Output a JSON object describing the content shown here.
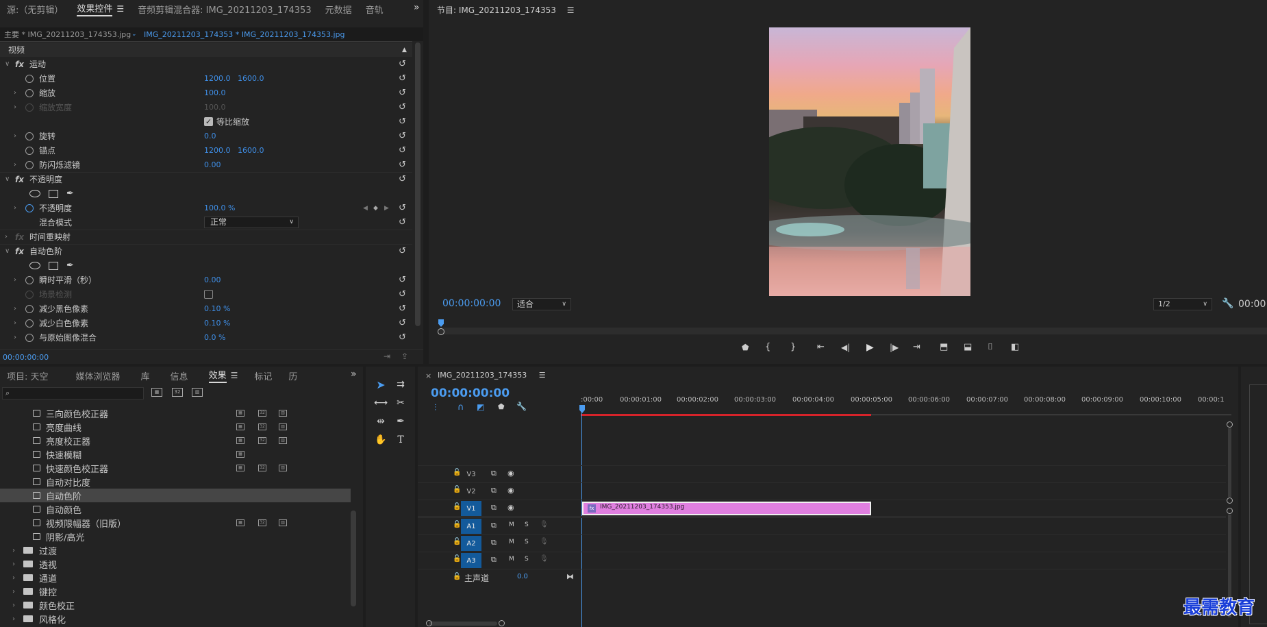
{
  "effect_controls_panel": {
    "tabs": [
      "源:（无剪辑）",
      "效果控件",
      "音频剪辑混合器: IMG_20211203_174353",
      "元数据",
      "音轨"
    ],
    "active_tab": "效果控件",
    "master_clip": "主要 * IMG_20211203_174353.jpg",
    "sequence_clip": "IMG_20211203_174353 * IMG_20211203_174353.jpg",
    "section_video": "视频",
    "motion": {
      "label": "运动",
      "position": {
        "label": "位置",
        "x": "1200.0",
        "y": "1600.0"
      },
      "scale": {
        "label": "缩放",
        "value": "100.0"
      },
      "scale_width": {
        "label": "缩放宽度",
        "value": "100.0"
      },
      "uniform_scale": "等比缩放",
      "rotation": {
        "label": "旋转",
        "value": "0.0"
      },
      "anchor": {
        "label": "锚点",
        "x": "1200.0",
        "y": "1600.0"
      },
      "anti_flicker": {
        "label": "防闪烁滤镜",
        "value": "0.00"
      }
    },
    "opacity": {
      "label": "不透明度",
      "opacity": {
        "label": "不透明度",
        "value": "100.0 %"
      },
      "blend_mode": {
        "label": "混合模式",
        "value": "正常"
      }
    },
    "time_remap": "时间重映射",
    "auto_levels": {
      "label": "自动色阶",
      "smoothing": {
        "label": "瞬时平滑（秒）",
        "value": "0.00"
      },
      "scene_detect": "场景检测",
      "black_clip": {
        "label": "减少黑色像素",
        "value": "0.10 %"
      },
      "white_clip": {
        "label": "减少白色像素",
        "value": "0.10 %"
      },
      "blend_original": {
        "label": "与原始图像混合",
        "value": "0.0 %"
      }
    },
    "timecode": "00:00:00:00"
  },
  "program_monitor": {
    "title": "节目: IMG_20211203_174353",
    "timecode": "00:00:00:00",
    "fit": "适合",
    "resolution": "1/2",
    "timecode_right": "00:00:"
  },
  "project_panel": {
    "tabs": [
      "项目: 天空",
      "媒体浏览器",
      "库",
      "信息",
      "效果",
      "标记",
      "历"
    ],
    "active_tab": "效果",
    "search_placeholder": "",
    "effects": [
      "三向颜色校正器",
      "亮度曲线",
      "亮度校正器",
      "快速模糊",
      "快速颜色校正器",
      "自动对比度",
      "自动色阶",
      "自动颜色",
      "视频限幅器（旧版）",
      "阴影/高光"
    ],
    "selected_effect": "自动色阶",
    "folders": [
      "过渡",
      "透视",
      "通道",
      "键控",
      "颜色校正",
      "风格化"
    ]
  },
  "timeline": {
    "sequence_name": "IMG_20211203_174353",
    "timecode": "00:00:00:00",
    "ruler": [
      ":00:00",
      "00:00:01:00",
      "00:00:02:00",
      "00:00:03:00",
      "00:00:04:00",
      "00:00:05:00",
      "00:00:06:00",
      "00:00:07:00",
      "00:00:08:00",
      "00:00:09:00",
      "00:00:10:00",
      "00:00:1"
    ],
    "video_tracks": [
      "V3",
      "V2",
      "V1"
    ],
    "audio_tracks": [
      "A1",
      "A2",
      "A3"
    ],
    "master": {
      "label": "主声道",
      "value": "0.0"
    },
    "clip_name": "IMG_20211203_174353.jpg",
    "m": "M",
    "s": "S"
  },
  "watermark": "最需教育",
  "colors": {
    "accent": "#4b9cf0",
    "clip": "#e07fe0",
    "track_on": "#135a9b",
    "work_area": "#d6232a"
  }
}
